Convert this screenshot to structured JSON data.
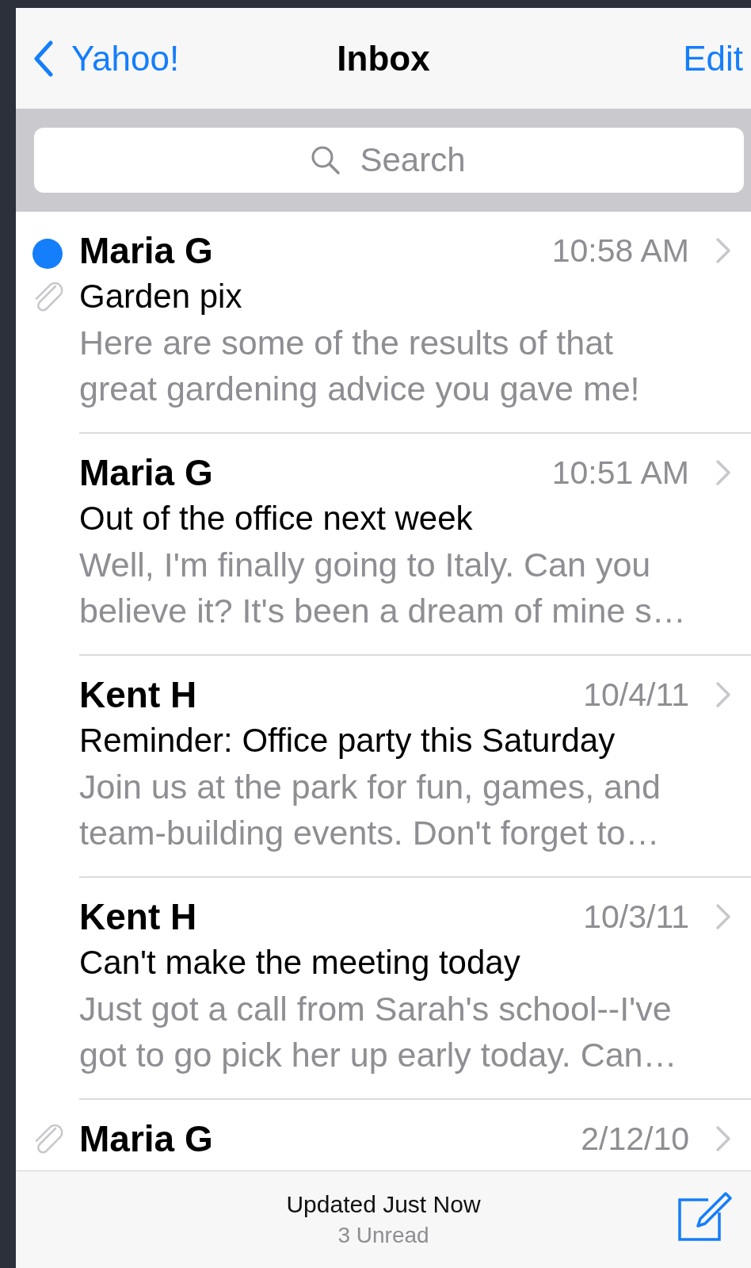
{
  "nav_bar": {
    "back_label": "Yahoo!",
    "title": "Inbox",
    "edit_label": "Edit"
  },
  "search": {
    "placeholder": "Search"
  },
  "messages": [
    {
      "sender": "Maria G",
      "time": "10:58 AM",
      "subject": "Garden pix",
      "preview_lines": [
        "Here are some of the results of that",
        "great gardening advice you gave me!"
      ],
      "unread": true,
      "attachment": true
    },
    {
      "sender": "Maria G",
      "time": "10:51 AM",
      "subject": "Out of the office next week",
      "preview_lines": [
        "Well, I'm finally going to Italy. Can you",
        "believe it? It's been a dream of mine s…"
      ],
      "unread": false,
      "attachment": false
    },
    {
      "sender": "Kent H",
      "time": "10/4/11",
      "subject": "Reminder: Office party this Saturday",
      "preview_lines": [
        "Join us at the park for fun, games, and",
        "team-building events. Don't forget to…"
      ],
      "unread": false,
      "attachment": false
    },
    {
      "sender": "Kent H",
      "time": "10/3/11",
      "subject": "Can't make the meeting today",
      "preview_lines": [
        "Just got a call from Sarah's school--I've",
        "got to go pick her up early today. Can…"
      ],
      "unread": false,
      "attachment": false
    },
    {
      "sender": "Maria G",
      "time": "2/12/10",
      "unread": false,
      "attachment": true
    }
  ],
  "toolbar": {
    "status": "Updated Just Now",
    "unread_count": "3 Unread"
  }
}
